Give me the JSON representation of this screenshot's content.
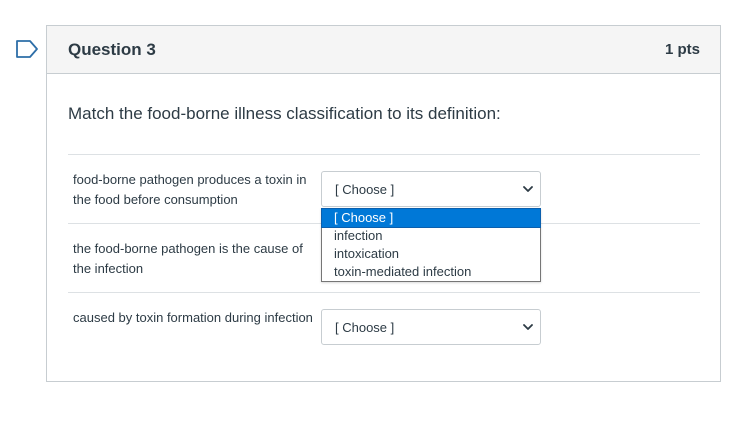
{
  "question": {
    "title": "Question 3",
    "points": "1 pts",
    "prompt": "Match the food-borne illness classification to its definition:"
  },
  "answers": [
    {
      "label": "food-borne pathogen produces a toxin in the food before consumption",
      "selected": "[ Choose ]"
    },
    {
      "label": "the food-borne pathogen is the cause of the infection",
      "selected": ""
    },
    {
      "label": "caused by toxin formation during infection",
      "selected": "[ Choose ]"
    }
  ],
  "dropdown": {
    "options": [
      "[ Choose ]",
      "infection",
      "intoxication",
      "toxin-mediated infection"
    ],
    "highlighted_index": 0
  },
  "colors": {
    "accent": "#0078d7",
    "header_bg": "#f5f5f5",
    "border": "#c7cdd1",
    "flag": "#2d6ea8"
  },
  "icons": {
    "flag": "flag-outline-icon",
    "select_arrow": "chevron-down-icon"
  }
}
